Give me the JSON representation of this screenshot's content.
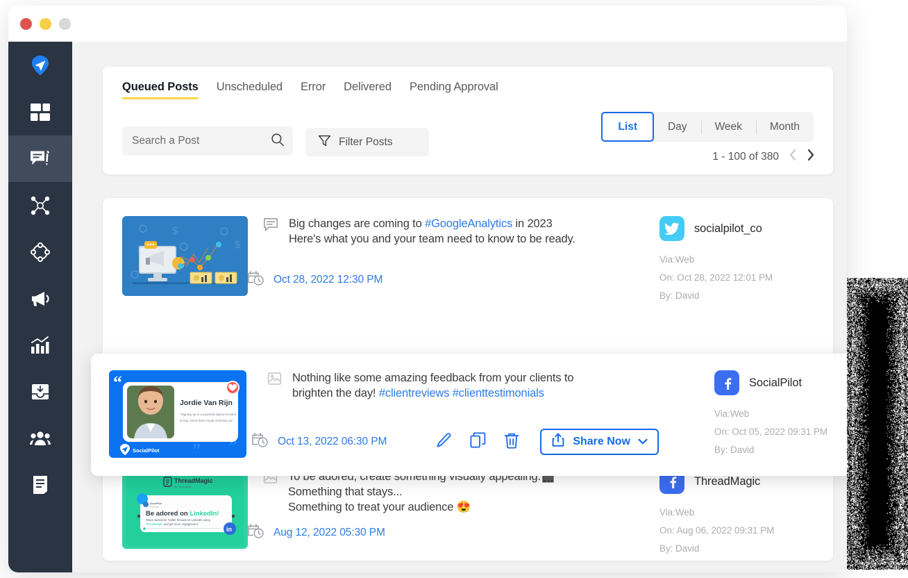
{
  "window": {
    "traffic_lights": [
      {
        "name": "close",
        "color": "#dc5550"
      },
      {
        "name": "minimize",
        "color": "#f5cf47"
      },
      {
        "name": "maximize",
        "color": "#d9d9d9"
      }
    ]
  },
  "sidebar": {
    "items": [
      {
        "icon": "paper-plane-logo-icon",
        "label": "SocialPilot",
        "active": false
      },
      {
        "icon": "dashboard-grid-icon",
        "label": "Dashboard",
        "active": false
      },
      {
        "icon": "compose-post-icon",
        "label": "Posts",
        "active": true
      },
      {
        "icon": "network-nodes-icon",
        "label": "Connections",
        "active": false
      },
      {
        "icon": "circle-nodes-icon",
        "label": "Discovery",
        "active": false
      },
      {
        "icon": "megaphone-icon",
        "label": "Campaigns",
        "active": false
      },
      {
        "icon": "analytics-chart-icon",
        "label": "Analytics",
        "active": false
      },
      {
        "icon": "inbox-download-icon",
        "label": "Inbox",
        "active": false
      },
      {
        "icon": "team-users-icon",
        "label": "Team",
        "active": false
      },
      {
        "icon": "report-document-icon",
        "label": "Reports",
        "active": false
      }
    ]
  },
  "header": {
    "tabs": [
      {
        "label": "Queued Posts",
        "active": true
      },
      {
        "label": "Unscheduled",
        "active": false
      },
      {
        "label": "Error",
        "active": false
      },
      {
        "label": "Delivered",
        "active": false
      },
      {
        "label": "Pending Approval",
        "active": false
      }
    ],
    "search": {
      "placeholder": "Search a Post",
      "value": ""
    },
    "filter_label": "Filter Posts",
    "view_options": [
      {
        "label": "List",
        "active": true
      },
      {
        "label": "Day",
        "active": false
      },
      {
        "label": "Week",
        "active": false
      },
      {
        "label": "Month",
        "active": false
      }
    ],
    "pagination": {
      "range": "1 - 100 of 380",
      "prev": "‹",
      "next": "›"
    }
  },
  "posts": [
    {
      "type_icon": "text-post-icon",
      "text_parts": [
        {
          "t": "Big changes are coming to ",
          "hash": false
        },
        {
          "t": "#GoogleAnalytics",
          "hash": true
        },
        {
          "t": " in 2023",
          "hash": false
        }
      ],
      "text_line2": "Here's what you and your team need to know to be ready.",
      "scheduled": "Oct 28, 2022 12:30 PM",
      "thumb": "google-analytics-illustration",
      "account": {
        "network": "twitter",
        "name": "socialpilot_co",
        "via": "Via:Web",
        "on": "On: Oct 28, 2022 12:01 PM",
        "by": "By: David"
      },
      "selected": false
    },
    {
      "type_icon": "image-post-icon",
      "text_parts": [
        {
          "t": "Nothing like some amazing feedback from your clients to brighten the day!  ",
          "hash": false
        },
        {
          "t": "#clientreviews",
          "hash": true
        },
        {
          "t": " ",
          "hash": false
        },
        {
          "t": "#clienttestimonials",
          "hash": true
        }
      ],
      "text_line2": "",
      "scheduled": "Oct 13, 2022 06:30 PM",
      "thumb": "testimonial-card",
      "thumb_content": {
        "person_name": "Jordie Van Rijn",
        "quote": "\"Signing up is a powerful signal of intent to buy. Send them email until they do.\"",
        "brand": "SocialPilot"
      },
      "actions": [
        {
          "icon": "edit-pencil-icon",
          "label": "Edit"
        },
        {
          "icon": "duplicate-icon",
          "label": "Duplicate"
        },
        {
          "icon": "delete-trash-icon",
          "label": "Delete"
        }
      ],
      "share_button": {
        "label": "Share Now",
        "icon": "share-upload-icon",
        "caret": "chevron-down-icon"
      },
      "account": {
        "network": "facebook",
        "name": "SocialPilot",
        "via": "Via:Web",
        "on": "On: Oct 05, 2022 09:31 PM",
        "by": "By: David"
      },
      "selected": true
    },
    {
      "type_icon": "image-post-icon",
      "text_parts": [
        {
          "t": "To be adored, create something visually appealing.🎬",
          "hash": false
        }
      ],
      "text_line2": "Something that stays...",
      "text_line3": "Something to treat your audience 😍",
      "scheduled": "Aug 12, 2022 05:30 PM",
      "thumb": "threadmagic-card",
      "thumb_content": {
        "brand": "ThreadMagic",
        "brand_sub": "By SocialPilot",
        "headline_a": "Be adored on ",
        "headline_b": "LinkedIn!",
        "body": "Share awesome Twitter threads on LinkedIn using ThreadMagic and get more engagement."
      },
      "account": {
        "network": "facebook",
        "name": "ThreadMagic",
        "via": "Via:Web",
        "on": "On: Aug 06, 2022 09:31 PM",
        "by": "By: David"
      },
      "selected": false
    }
  ],
  "colors": {
    "sidebar": "#2b3443",
    "sidebar_active": "#404b5c",
    "accent_blue": "#1669e8",
    "link_blue": "#2c7be5",
    "tab_underline": "#f8d649",
    "twitter": "#44ccf6",
    "facebook": "#3b6ef1",
    "content_bg": "#f2f2f2"
  }
}
